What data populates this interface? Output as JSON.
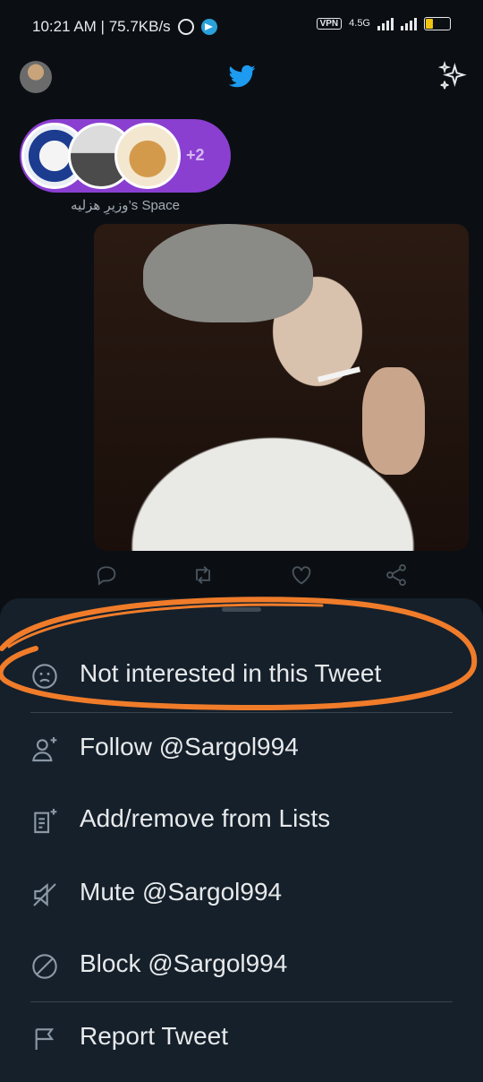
{
  "status_bar": {
    "time_speed": "10:21 AM | 75.7KB/s",
    "vpn": "VPN",
    "network": "4.5G",
    "battery": "27"
  },
  "spaces": {
    "more_count": "+2",
    "caption": "وزیرِ هزلیه’s Space"
  },
  "menu": {
    "items": [
      {
        "label": "Not interested in this Tweet",
        "icon": "frown-face-icon"
      },
      {
        "label": "Follow @Sargol994",
        "icon": "follow-user-icon"
      },
      {
        "label": "Add/remove from Lists",
        "icon": "list-add-icon"
      },
      {
        "label": "Mute @Sargol994",
        "icon": "mute-icon"
      },
      {
        "label": "Block @Sargol994",
        "icon": "block-icon"
      },
      {
        "label": "Report Tweet",
        "icon": "flag-icon"
      }
    ]
  },
  "colors": {
    "twitter_blue": "#1d9bf0",
    "spaces_purple": "#8a3fd1",
    "sheet_bg": "#15202b",
    "annotation_orange": "#f07c2a"
  }
}
